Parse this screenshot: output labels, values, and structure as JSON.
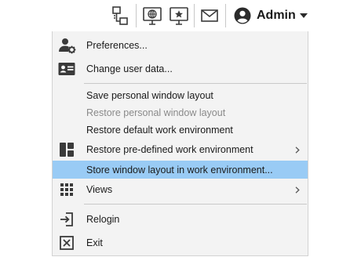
{
  "toolbar": {
    "icons": [
      {
        "name": "network-icon"
      },
      {
        "name": "monitor-globe-icon"
      },
      {
        "name": "monitor-star-icon"
      },
      {
        "name": "mail-icon"
      }
    ],
    "user": {
      "name": "Admin",
      "avatar_icon": "user-circle-icon",
      "menu_icon": "caret-down-icon"
    }
  },
  "menu": {
    "items": [
      {
        "label": "Preferences...",
        "icon": "user-gear-icon",
        "enabled": true
      },
      {
        "label": "Change user data...",
        "icon": "id-card-icon",
        "enabled": true
      },
      {
        "label": "Save personal window layout",
        "enabled": true
      },
      {
        "label": "Restore personal window layout",
        "enabled": false
      },
      {
        "label": "Restore default work environment",
        "enabled": true
      },
      {
        "label": "Restore pre-defined work environment",
        "icon": "layout-icon",
        "enabled": true,
        "submenu": true
      },
      {
        "label": "Store window layout in work environment...",
        "enabled": true,
        "highlighted": true
      },
      {
        "label": "Views",
        "icon": "grid-icon",
        "enabled": true,
        "submenu": true
      },
      {
        "label": "Relogin",
        "icon": "relogin-icon",
        "enabled": true
      },
      {
        "label": "Exit",
        "icon": "exit-icon",
        "enabled": true
      }
    ]
  },
  "colors": {
    "highlight": "#99cbf5",
    "menu_background": "#f3f3f3",
    "disabled_text": "#8a8a8a",
    "icon_dark": "#3a3a3a"
  }
}
